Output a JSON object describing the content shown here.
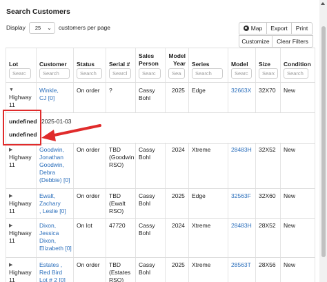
{
  "page": {
    "title": "Search Customers"
  },
  "display": {
    "label": "Display",
    "value": "25",
    "suffix": "customers per page"
  },
  "toolbar": {
    "map": "Map",
    "export": "Export",
    "print": "Print",
    "customize": "Customize",
    "clear_filters": "Clear Filters"
  },
  "columns": [
    {
      "label": "Lot",
      "placeholder": "Searc"
    },
    {
      "label": "Customer",
      "placeholder": "Search"
    },
    {
      "label": "Status",
      "placeholder": "Search"
    },
    {
      "label": "Serial #",
      "placeholder": "Searcl"
    },
    {
      "label": "Sales\nPerson",
      "placeholder": "Searc"
    },
    {
      "label": "Model\nYear",
      "placeholder": "Sear"
    },
    {
      "label": "Series",
      "placeholder": "Search"
    },
    {
      "label": "Model",
      "placeholder": "Search"
    },
    {
      "label": "Size",
      "placeholder": "Searc"
    },
    {
      "label": "Condition",
      "placeholder": "Search"
    }
  ],
  "rows": [
    {
      "toggle": "▼",
      "lot": "Highway\n11",
      "customer": "Winkle,\nCJ [0]",
      "status": "On order",
      "serial": "?",
      "sales_person": "Cassy\nBohl",
      "year": "2025",
      "series": "Edge",
      "model": "32663X",
      "size": "32X70",
      "condition": "New"
    },
    {
      "toggle": "▶",
      "lot": "Highway\n11",
      "customer": "Goodwin,\nJonathan\nGoodwin,\nDebra\n(Debbie) [0]",
      "status": "On order",
      "serial": "TBD\n(Goodwin\nRSO)",
      "sales_person": "Cassy\nBohl",
      "year": "2024",
      "series": "Xtreme",
      "model": "28483H",
      "size": "32X52",
      "condition": "New"
    },
    {
      "toggle": "▶",
      "lot": "Highway\n11",
      "customer": "Ewalt,\nZachary\n, Leslie [0]",
      "status": "On order",
      "serial": "TBD\n(Ewalt\nRSO)",
      "sales_person": "Cassy\nBohl",
      "year": "2025",
      "series": "Edge",
      "model": "32563F",
      "size": "32X60",
      "condition": "New"
    },
    {
      "toggle": "▶",
      "lot": "Highway\n11",
      "customer": "Dixon,\nJessica\nDixon,\nElizabeth [0]",
      "status": "On lot",
      "serial": "47720",
      "sales_person": "Cassy\nBohl",
      "year": "2024",
      "series": "Xtreme",
      "model": "28483H",
      "size": "28X52",
      "condition": "New"
    },
    {
      "toggle": "▶",
      "lot": "Highway\n11",
      "customer": "Estates ,\nRed Bird\nLot # 2 [0]",
      "status": "On order",
      "serial": "TBD\n(Estates\nRSO)",
      "sales_person": "Cassy\nBohl",
      "year": "2025",
      "series": "Xtreme",
      "model": "28563T",
      "size": "28X56",
      "condition": "New"
    }
  ],
  "detail": {
    "label1": "undefined",
    "value1": "2025-01-03",
    "label2": "undefined"
  },
  "colors": {
    "link": "#2a6ebb",
    "annotation": "#e02b2b"
  }
}
